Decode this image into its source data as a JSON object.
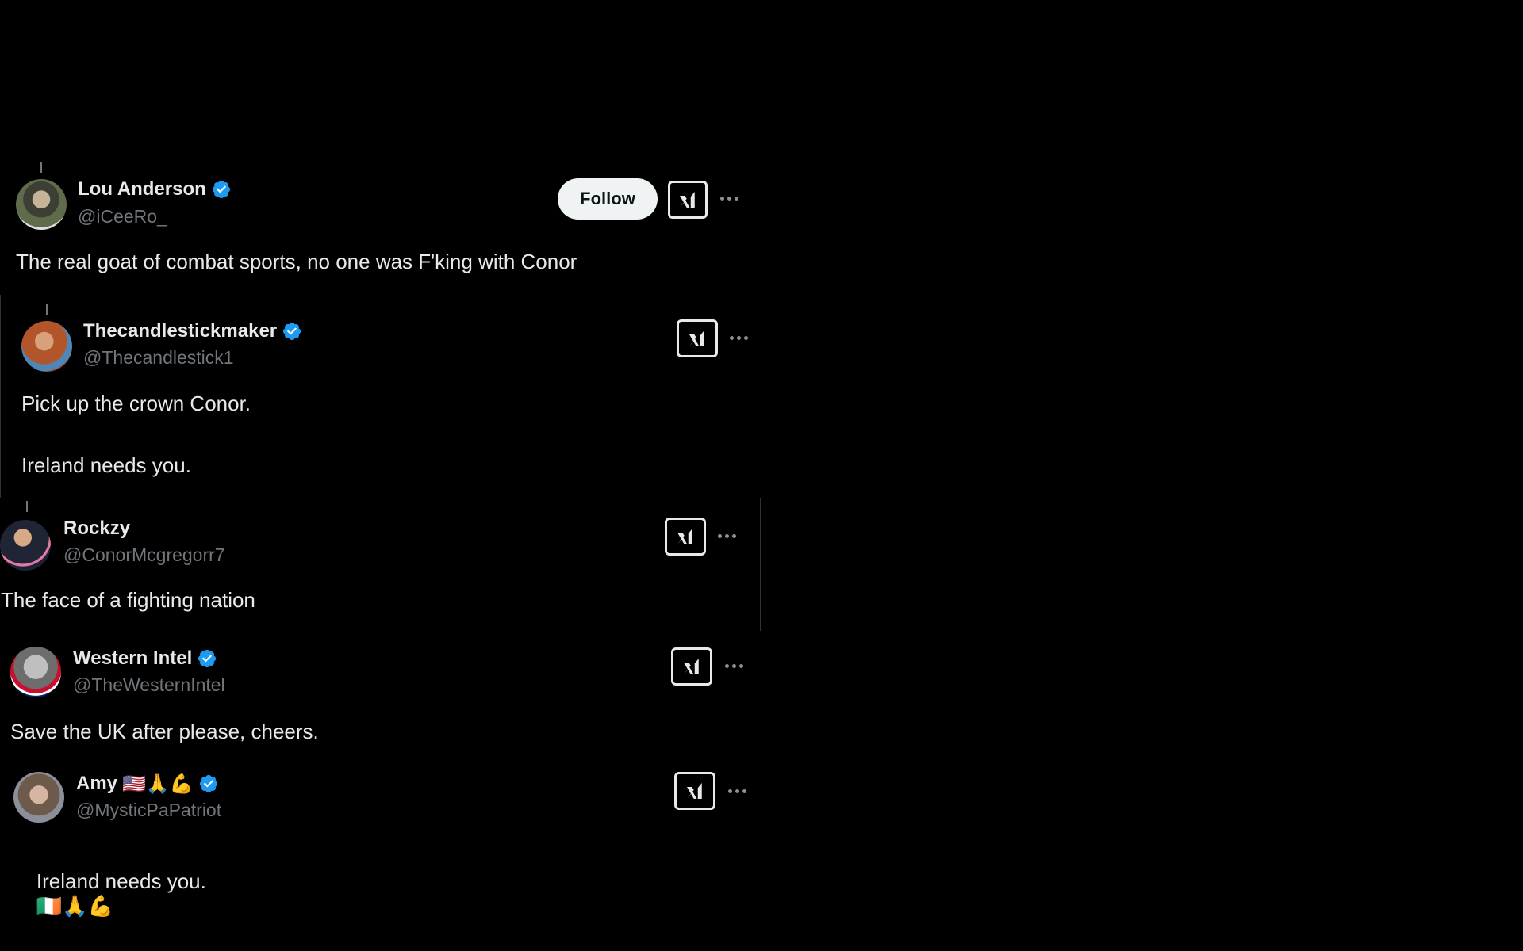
{
  "colors": {
    "background": "#000000",
    "text_primary": "#e7e9ea",
    "text_secondary": "#71767b",
    "verified_blue": "#1d9bf0",
    "follow_bg": "#eff3f4"
  },
  "posts": [
    {
      "display_name": "Lou Anderson",
      "verified": true,
      "handle": "@iCeeRo_",
      "text": "The real goat of combat sports, no one was F'king with Conor",
      "follow_label": "Follow",
      "avatar_icon": "user-avatar",
      "grok_icon": "grok-icon",
      "more_icon": "more-options-icon"
    },
    {
      "display_name": "Thecandlestickmaker",
      "verified": true,
      "handle": "@Thecandlestick1",
      "text_lines": [
        "Pick up the crown Conor.",
        "Ireland needs you."
      ],
      "avatar_icon": "user-avatar",
      "grok_icon": "grok-icon",
      "more_icon": "more-options-icon"
    },
    {
      "display_name": "Rockzy",
      "verified": false,
      "handle": "@ConorMcgregorr7",
      "text": "The face of a fighting nation",
      "avatar_icon": "user-avatar",
      "grok_icon": "grok-icon",
      "more_icon": "more-options-icon"
    },
    {
      "display_name": "Western Intel",
      "verified": true,
      "handle": "@TheWesternIntel",
      "text": "Save the UK after please, cheers.",
      "avatar_icon": "user-avatar",
      "grok_icon": "grok-icon",
      "more_icon": "more-options-icon"
    },
    {
      "display_name": "Amy",
      "name_emojis": "🇺🇸🙏💪",
      "verified": true,
      "handle": "@MysticPaPatriot",
      "text": "Ireland needs you.",
      "text_emojis": "🇮🇪🙏💪",
      "avatar_icon": "user-avatar",
      "grok_icon": "grok-icon",
      "more_icon": "more-options-icon"
    }
  ]
}
